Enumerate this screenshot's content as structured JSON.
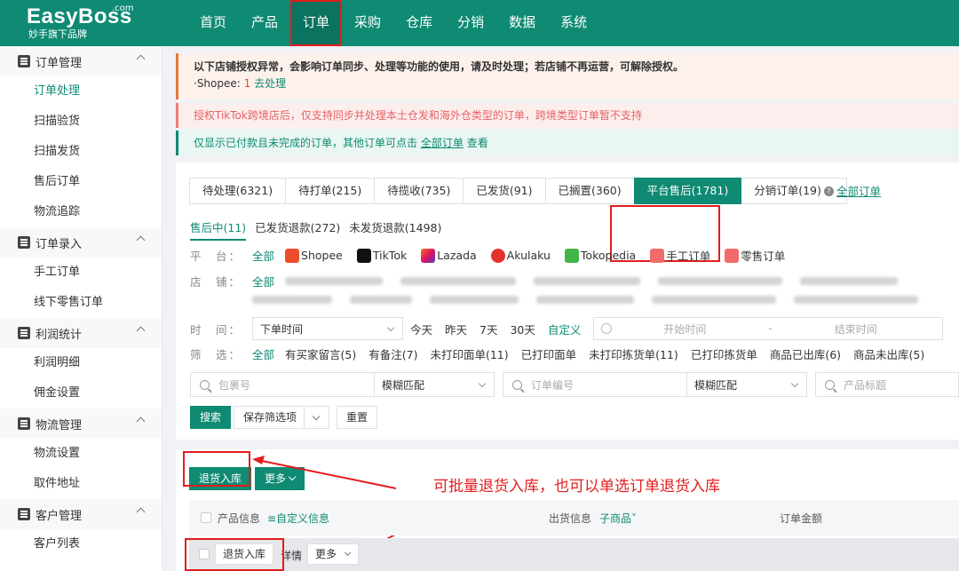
{
  "brand": {
    "name": "EasyBoss",
    "suffix": ".com",
    "tagline": "妙手旗下品牌"
  },
  "topnav": [
    "首页",
    "产品",
    "订单",
    "采购",
    "仓库",
    "分销",
    "数据",
    "系统"
  ],
  "sidebar": {
    "groups": [
      {
        "label": "订单管理",
        "items": [
          "订单处理",
          "扫描验货",
          "扫描发货",
          "售后订单",
          "物流追踪"
        ]
      },
      {
        "label": "订单录入",
        "items": [
          "手工订单",
          "线下零售订单"
        ]
      },
      {
        "label": "利润统计",
        "items": [
          "利润明细",
          "佣金设置"
        ]
      },
      {
        "label": "物流管理",
        "items": [
          "物流设置",
          "取件地址"
        ]
      },
      {
        "label": "客户管理",
        "items": [
          "客户列表"
        ]
      }
    ],
    "active_item": "订单处理"
  },
  "banners": {
    "auth_title": "以下店铺授权异常，会影响订单同步、处理等功能的使用，请及时处理；若店铺不再运营，可解除授权。",
    "auth_shop": "·Shopee:",
    "auth_count": "1",
    "auth_link": "去处理",
    "tiktok_notice": "授权TikTok跨境店后，仅支持同步并处理本土仓发和海外仓类型的订单，跨境类型订单暂不支持",
    "paid_prefix": "仅显示已付款且未完成的订单，其他订单可点击",
    "paid_link": "全部订单",
    "paid_suffix": "查看"
  },
  "tabs": [
    "待处理(6321)",
    "待打单(215)",
    "待揽收(735)",
    "已发货(91)",
    "已搁置(360)",
    "平台售后(1781)",
    "分销订单(19)"
  ],
  "tab_active": "平台售后(1781)",
  "tab_all": "全部订单",
  "subtabs": [
    "售后中(11)",
    "已发货退款(272)",
    "未发货退款(1498)"
  ],
  "filters": {
    "platform_label": "平　台：",
    "all": "全部",
    "platforms": [
      "Shopee",
      "TikTok",
      "Lazada",
      "Akulaku",
      "Tokopedia",
      "手工订单",
      "零售订单"
    ],
    "shop_label": "店　铺：",
    "time_label": "时　间：",
    "time_type": "下单时间",
    "time_quick": [
      "今天",
      "昨天",
      "7天",
      "30天"
    ],
    "time_custom": "自定义",
    "start_placeholder": "开始时间",
    "dash": "-",
    "end_placeholder": "结束时间",
    "filter_label": "筛　选：",
    "filter_items": [
      "有买家留言(5)",
      "有备注(7)",
      "未打印面单(11)",
      "已打印面单",
      "未打印拣货单(11)",
      "已打印拣货单",
      "商品已出库(6)",
      "商品未出库(5)"
    ]
  },
  "search": {
    "package_placeholder": "包裹号",
    "match_mode": "模糊匹配",
    "order_placeholder": "订单编号",
    "match_mode2": "模糊匹配",
    "title_placeholder": "产品标题",
    "search_btn": "搜索",
    "save_btn": "保存筛选项",
    "reset_btn": "重置"
  },
  "list": {
    "return_btn": "退货入库",
    "more_btn": "更多",
    "annotation": "可批量退货入库，也可以单选订单退货入库",
    "col_product": "产品信息",
    "col_custom": "≡自定义信息",
    "col_ship": "出货信息",
    "col_sub": "子商品",
    "col_amount": "订单金额",
    "row_return_btn": "退货入库",
    "row_detail": "详情",
    "row_more": "更多"
  },
  "colors": {
    "brand": "#0f8a73",
    "highlight": "#e21d1d"
  }
}
